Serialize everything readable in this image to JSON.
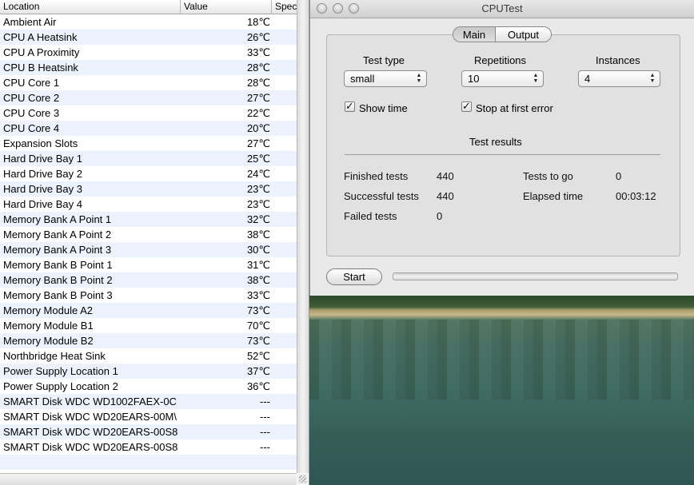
{
  "sensor_table": {
    "columns": [
      "Location",
      "Value",
      "Spec"
    ],
    "rows": [
      {
        "location": "Ambient Air",
        "value": "18℃"
      },
      {
        "location": "CPU A Heatsink",
        "value": "26℃"
      },
      {
        "location": "CPU A Proximity",
        "value": "33℃"
      },
      {
        "location": "CPU B Heatsink",
        "value": "28℃"
      },
      {
        "location": "CPU Core 1",
        "value": "28℃"
      },
      {
        "location": "CPU Core 2",
        "value": "27℃"
      },
      {
        "location": "CPU Core 3",
        "value": "22℃"
      },
      {
        "location": "CPU Core 4",
        "value": "20℃"
      },
      {
        "location": "Expansion Slots",
        "value": "27℃"
      },
      {
        "location": "Hard Drive Bay 1",
        "value": "25℃"
      },
      {
        "location": "Hard Drive Bay 2",
        "value": "24℃"
      },
      {
        "location": "Hard Drive Bay 3",
        "value": "23℃"
      },
      {
        "location": "Hard Drive Bay 4",
        "value": "23℃"
      },
      {
        "location": "Memory Bank A Point 1",
        "value": "32℃"
      },
      {
        "location": "Memory Bank A Point 2",
        "value": "38℃"
      },
      {
        "location": "Memory Bank A Point 3",
        "value": "30℃"
      },
      {
        "location": "Memory Bank B Point 1",
        "value": "31℃"
      },
      {
        "location": "Memory Bank B Point 2",
        "value": "38℃"
      },
      {
        "location": "Memory Bank B Point 3",
        "value": "33℃"
      },
      {
        "location": "Memory Module A2",
        "value": "73℃"
      },
      {
        "location": "Memory Module B1",
        "value": "70℃"
      },
      {
        "location": "Memory Module B2",
        "value": "73℃"
      },
      {
        "location": "Northbridge Heat Sink",
        "value": "52℃"
      },
      {
        "location": "Power Supply Location 1",
        "value": "37℃"
      },
      {
        "location": "Power Supply Location 2",
        "value": "36℃"
      },
      {
        "location": "SMART Disk WDC WD1002FAEX-0C",
        "value": "---"
      },
      {
        "location": "SMART Disk WDC WD20EARS-00M\\",
        "value": "---"
      },
      {
        "location": "SMART Disk WDC WD20EARS-00S8",
        "value": "---"
      },
      {
        "location": "SMART Disk WDC WD20EARS-00S8",
        "value": "---"
      },
      {
        "location": "",
        "value": ""
      }
    ]
  },
  "cputest": {
    "window_title": "CPUTest",
    "tabs": [
      {
        "label": "Main",
        "selected": true
      },
      {
        "label": "Output",
        "selected": false
      }
    ],
    "test_type": {
      "label": "Test type",
      "value": "small"
    },
    "repetitions": {
      "label": "Repetitions",
      "value": "10"
    },
    "instances": {
      "label": "Instances",
      "value": "4"
    },
    "show_time": {
      "label": "Show time",
      "checked": true
    },
    "stop_first_error": {
      "label": "Stop at first error",
      "checked": true
    },
    "results_title": "Test results",
    "results": {
      "finished_label": "Finished tests",
      "finished_value": "440",
      "successful_label": "Successful tests",
      "successful_value": "440",
      "failed_label": "Failed tests",
      "failed_value": "0",
      "to_go_label": "Tests to go",
      "to_go_value": "0",
      "elapsed_label": "Elapsed time",
      "elapsed_value": "00:03:12"
    },
    "start_label": "Start",
    "progress": 0
  },
  "colors": {
    "row_alt": "#edf3fe",
    "window_bg": "#e9e9e9",
    "panel_bg": "#e1e1e1"
  },
  "icons": {
    "checkbox_check": "check-icon",
    "select_arrows": "up-down-arrows-icon"
  }
}
